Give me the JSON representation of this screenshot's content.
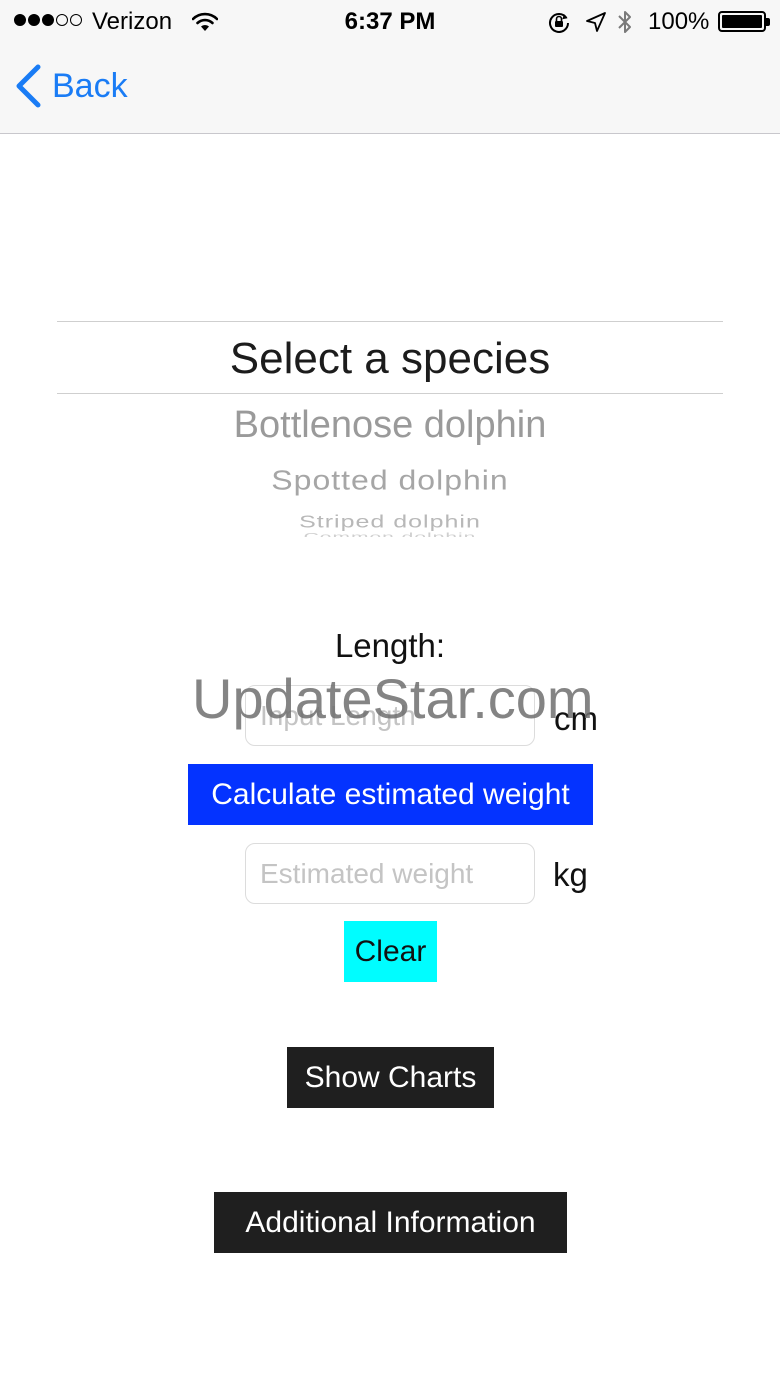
{
  "status_bar": {
    "carrier": "Verizon",
    "time": "6:37 PM",
    "battery_percent": "100%",
    "signal_bars_filled": 3,
    "signal_bars_total": 5
  },
  "nav": {
    "back_label": "Back"
  },
  "picker": {
    "selected": "Select a species",
    "options": [
      "Bottlenose dolphin",
      "Spotted dolphin",
      "Striped dolphin",
      "Common dolphin"
    ]
  },
  "length": {
    "label": "Length:",
    "placeholder": "Input Length",
    "unit": "cm"
  },
  "calculate_button": "Calculate estimated weight",
  "weight": {
    "placeholder": "Estimated weight",
    "unit": "kg"
  },
  "clear_button": "Clear",
  "show_charts_button": "Show Charts",
  "additional_info_button": "Additional Information",
  "watermark": "UpdateStar.com",
  "colors": {
    "accent": "#1a7cf5",
    "calculate_bg": "#0433ff",
    "clear_bg": "#00fdff",
    "dark_button_bg": "#1f1f1f"
  }
}
